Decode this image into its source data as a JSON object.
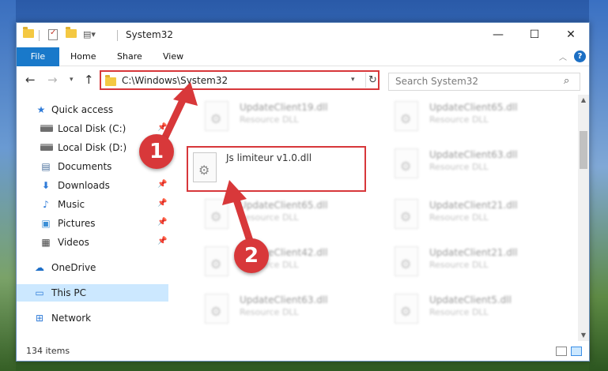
{
  "window": {
    "title": "System32",
    "minimize_glyph": "—",
    "maximize_glyph": "☐",
    "close_glyph": "✕",
    "accent_color": "#1979ca"
  },
  "ribbon": {
    "tabs": [
      {
        "label": "File",
        "active": true
      },
      {
        "label": "Home"
      },
      {
        "label": "Share"
      },
      {
        "label": "View"
      }
    ],
    "help_glyph": "?"
  },
  "nav": {
    "back_glyph": "←",
    "forward_glyph": "→",
    "recent_glyph": "▾",
    "up_glyph": "↑",
    "address": "C:\\Windows\\System32",
    "refresh_glyph": "↻",
    "search_placeholder": "Search System32"
  },
  "sidebar": {
    "items": [
      {
        "label": "Quick access",
        "icon": "star-icon",
        "pinned": false
      },
      {
        "label": "Local Disk (C:)",
        "icon": "disk-icon",
        "pinned": true
      },
      {
        "label": "Local Disk (D:)",
        "icon": "disk-icon",
        "pinned": true
      },
      {
        "label": "Documents",
        "icon": "documents-icon",
        "pinned": true
      },
      {
        "label": "Downloads",
        "icon": "download-icon",
        "pinned": true
      },
      {
        "label": "Music",
        "icon": "music-icon",
        "pinned": true
      },
      {
        "label": "Pictures",
        "icon": "pictures-icon",
        "pinned": true
      },
      {
        "label": "Videos",
        "icon": "videos-icon",
        "pinned": true
      },
      {
        "label": "OneDrive",
        "icon": "cloud-icon",
        "pinned": false
      },
      {
        "label": "This PC",
        "icon": "computer-icon",
        "pinned": false,
        "selected": true
      },
      {
        "label": "Network",
        "icon": "network-icon",
        "pinned": false
      }
    ]
  },
  "files": {
    "left_column": [
      {
        "name": "UpdateClient19.dll",
        "type": "Resource DLL"
      },
      {
        "name": "Js limiteur v1.0.dll",
        "type": "",
        "highlighted": true
      },
      {
        "name": "UpdateClient65.dll",
        "type": "Resource DLL"
      },
      {
        "name": "UpdateClient42.dll",
        "type": "Resource DLL"
      },
      {
        "name": "UpdateClient63.dll",
        "type": "Resource DLL"
      }
    ],
    "right_column": [
      {
        "name": "UpdateClient65.dll",
        "type": "Resource DLL"
      },
      {
        "name": "UpdateClient63.dll",
        "type": "Resource DLL"
      },
      {
        "name": "UpdateClient21.dll",
        "type": "Resource DLL"
      },
      {
        "name": "UpdateClient21.dll",
        "type": "Resource DLL"
      },
      {
        "name": "UpdateClient5.dll",
        "type": "Resource DLL"
      }
    ]
  },
  "status": {
    "item_count": "134 items"
  },
  "annotations": {
    "step1": "1",
    "step2": "2",
    "color": "#d8383a"
  }
}
